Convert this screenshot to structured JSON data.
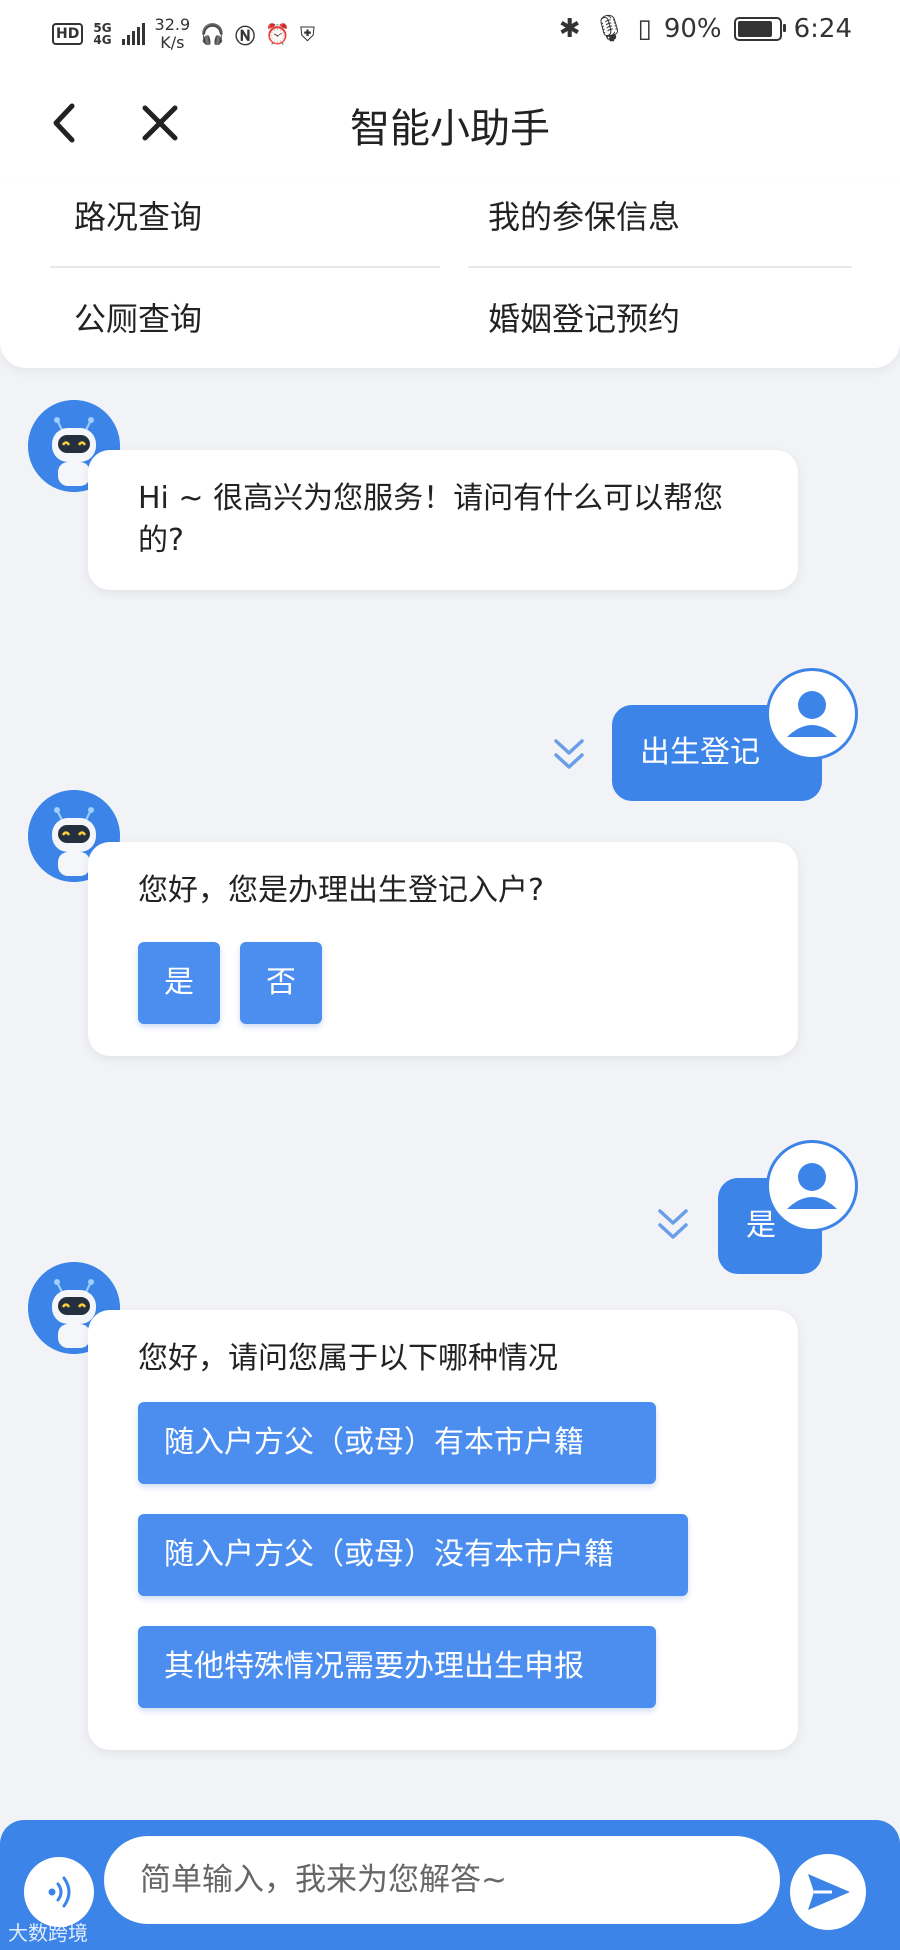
{
  "status_bar": {
    "hd": "HD",
    "network": "5G",
    "network_sub": "4G",
    "speed_value": "32.9",
    "speed_unit": "K/s",
    "battery_percent": "90%",
    "time": "6:24"
  },
  "header": {
    "title": "智能小助手"
  },
  "quick_menu": {
    "items": [
      {
        "label": "路况查询"
      },
      {
        "label": "我的参保信息"
      },
      {
        "label": "公厕查询"
      },
      {
        "label": "婚姻登记预约"
      }
    ]
  },
  "chat": {
    "bot_greeting": "Hi ~ 很高兴为您服务！请问有什么可以帮您的?",
    "user_msg_1": "出生登记",
    "bot_question_1": "您好，您是办理出生登记入户?",
    "yes_label": "是",
    "no_label": "否",
    "user_msg_2": "是",
    "bot_question_2": "您好，请问您属于以下哪种情况",
    "options": [
      "随入户方父（或母）有本市户籍",
      "随入户方父（或母）没有本市户籍",
      "其他特殊情况需要办理出生申报"
    ]
  },
  "input": {
    "placeholder": "简单输入，我来为您解答~"
  },
  "watermark": "大数跨境",
  "colors": {
    "accent": "#3c84e8",
    "button": "#4b8ef0",
    "background": "#f1f3f7"
  }
}
